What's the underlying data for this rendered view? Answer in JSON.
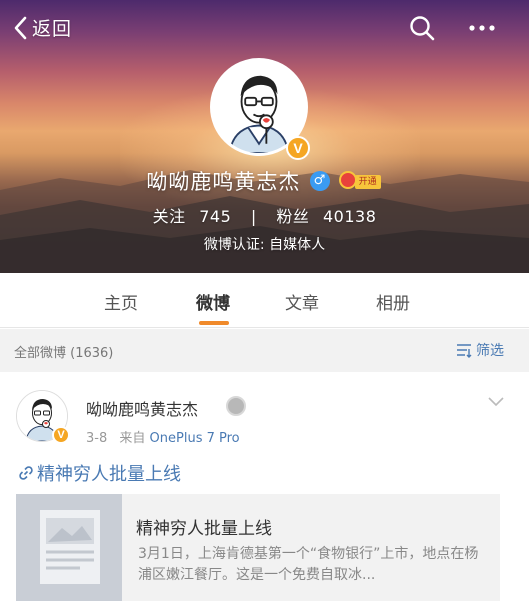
{
  "header": {
    "back_label": "返回",
    "name": "呦呦鹿鸣黄志杰",
    "gender_symbol": "♂",
    "vip_label": "开通",
    "verified_mark": "V",
    "stats": {
      "following_label": "关注",
      "following_count": "745",
      "separator": "|",
      "followers_label": "粉丝",
      "followers_count": "40138"
    },
    "verification": "微博认证: 自媒体人",
    "icons": [
      "back-chevron-icon",
      "search-icon",
      "more-icon"
    ]
  },
  "tabs": [
    {
      "label": "主页",
      "active": false
    },
    {
      "label": "微博",
      "active": true
    },
    {
      "label": "文章",
      "active": false
    },
    {
      "label": "相册",
      "active": false
    }
  ],
  "filterbar": {
    "count_label": "全部微博 (1636)",
    "filter_label": "筛选"
  },
  "post": {
    "author": "呦呦鹿鸣黄志杰",
    "verified_mark": "V",
    "date": "3-8",
    "from_label": "来自",
    "device": "OnePlus 7 Pro",
    "link_text": "精神穷人批量上线",
    "card": {
      "title": "精神穷人批量上线",
      "description": "3月1日，上海肯德基第一个“食物银行”上市，地点在杨浦区嫩江餐厅。这是一个免费自取冰..."
    }
  },
  "colors": {
    "accent": "#f08a2b",
    "link": "#4a7ab3",
    "verified": "#f5a623",
    "gender": "#3a9bf2"
  }
}
